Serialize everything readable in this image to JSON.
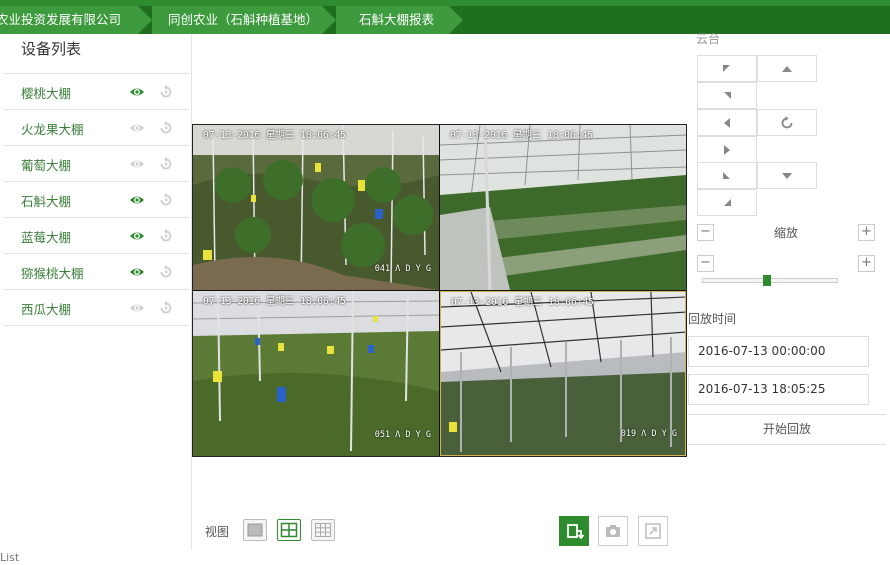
{
  "breadcrumb": [
    {
      "label": "农业投资发展有限公司"
    },
    {
      "label": "同创农业（石斛种植基地）"
    },
    {
      "label": "石斛大棚报表"
    }
  ],
  "sidebar": {
    "title": "设备列表",
    "devices": [
      {
        "name": "樱桃大棚",
        "online": true
      },
      {
        "name": "火龙果大棚",
        "online": false
      },
      {
        "name": "葡萄大棚",
        "online": false
      },
      {
        "name": "石斛大棚",
        "online": true
      },
      {
        "name": "蓝莓大棚",
        "online": true
      },
      {
        "name": "猕猴桃大棚",
        "online": true
      },
      {
        "name": "西瓜大棚",
        "online": false
      }
    ]
  },
  "cameras": [
    {
      "timestamp": "07-13-2016 星期三 18:06:45",
      "id": "041 Λ D Y G"
    },
    {
      "timestamp": "07-13-2016 星期三 18:06:45",
      "id": ""
    },
    {
      "timestamp": "07-13-2016 星期三 18:06:45",
      "id": "051 Λ D Y G"
    },
    {
      "timestamp": "07-13-2016 星期三 18:06:45",
      "id": "019 Λ D Y G"
    }
  ],
  "toolbar": {
    "view_label": "视图",
    "selected_layout": "2x2"
  },
  "ptz": {
    "title": "云台",
    "zoom_label": "缩放",
    "zoom_level": 0.47
  },
  "playback": {
    "label": "回放时间",
    "start_time": "2016-07-13 00:00:00",
    "end_time": "2016-07-13 18:05:25",
    "start_button": "开始回放"
  },
  "footer": {
    "text": "List"
  },
  "colors": {
    "accent": "#2e8b2e",
    "header": "#1f6f1f"
  }
}
